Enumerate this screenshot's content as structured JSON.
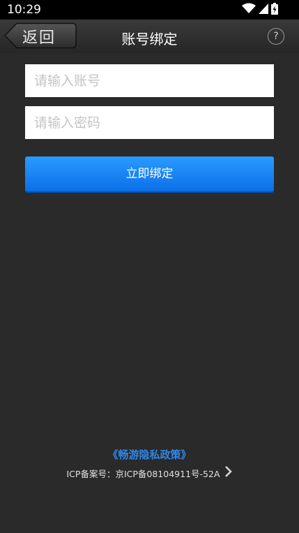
{
  "status_bar": {
    "time": "10:29",
    "icons": [
      "wifi-icon",
      "signal-icon",
      "battery-icon"
    ]
  },
  "title_bar": {
    "back_label": "返回",
    "title": "账号绑定",
    "help_label": "?"
  },
  "form": {
    "account_placeholder": "请输入账号",
    "password_placeholder": "请输入密码",
    "submit_label": "立即绑定"
  },
  "footer": {
    "policy_link": "《畅游隐私政策》",
    "icp": "ICP备案号：京ICP备08104911号-52A"
  },
  "colors": {
    "background": "#2a2a2a",
    "accent": "#1a86f5",
    "link": "#2f86e6"
  }
}
